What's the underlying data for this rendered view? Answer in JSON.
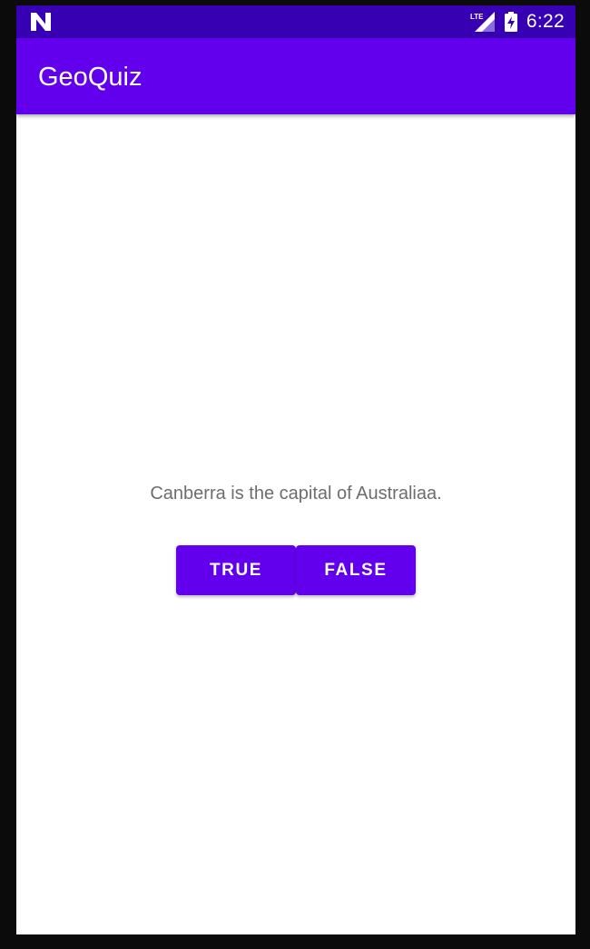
{
  "status_bar": {
    "time": "6:22",
    "network_label": "LTE",
    "icons": [
      "notification-n-icon",
      "lte-signal-icon",
      "battery-charging-icon"
    ],
    "background": "#3700b3"
  },
  "app_bar": {
    "title": "GeoQuiz",
    "background": "#6200ee"
  },
  "quiz": {
    "question": "Canberra is the capital of Australiaa.",
    "true_label": "TRUE",
    "false_label": "FALSE",
    "button_color": "#6200ee"
  }
}
